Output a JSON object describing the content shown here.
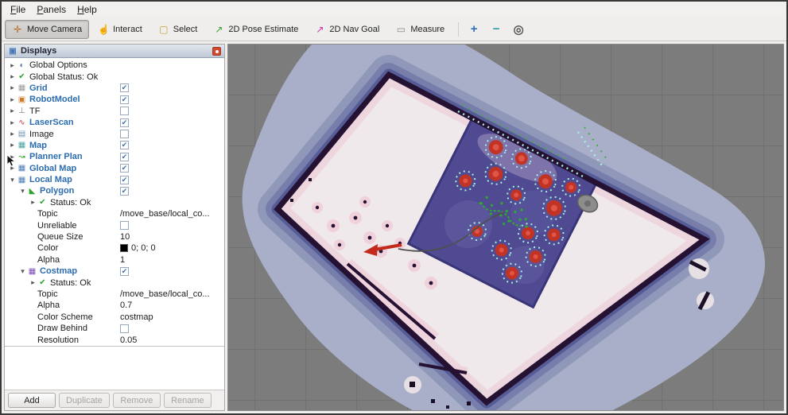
{
  "colors": {
    "accent_blue": "#2b6cb0",
    "viewport_bg": "#7c7c7c",
    "wall": "#251233",
    "inflation_blue": "#a9afc9",
    "costmap_square": "#46418c",
    "lethal_red": "#c03325",
    "laser_green": "#2ea82e",
    "speckle_cyan": "#a8ece4",
    "pose_arrow_red": "#c22a1c",
    "close_button_red": "#d2492f"
  },
  "menu": {
    "items": [
      "File",
      "Panels",
      "Help"
    ]
  },
  "toolbar": {
    "tools": [
      {
        "label": "Move Camera",
        "icon": "move-camera-icon",
        "active": true
      },
      {
        "label": "Interact",
        "icon": "interact-icon",
        "active": false
      },
      {
        "label": "Select",
        "icon": "select-icon",
        "active": false
      },
      {
        "label": "2D Pose Estimate",
        "icon": "pose-estimate-icon",
        "active": false
      },
      {
        "label": "2D Nav Goal",
        "icon": "nav-goal-icon",
        "active": false
      },
      {
        "label": "Measure",
        "icon": "measure-icon",
        "active": false
      }
    ],
    "extra_buttons": [
      {
        "name": "add-tool",
        "icon": "plus-icon"
      },
      {
        "name": "remove-tool",
        "icon": "minus-icon"
      },
      {
        "name": "focus-camera",
        "icon": "focus-icon"
      }
    ]
  },
  "icons": {
    "move-camera-icon": {
      "glyph": "✛",
      "color": "#b86e2a"
    },
    "interact-icon": {
      "glyph": "☝",
      "color": "#b8932a"
    },
    "select-icon": {
      "glyph": "▢",
      "color": "#c3a42b"
    },
    "pose-estimate-icon": {
      "glyph": "↗",
      "color": "#2da12d"
    },
    "nav-goal-icon": {
      "glyph": "↗",
      "color": "#cc2fa0"
    },
    "measure-icon": {
      "glyph": "▭",
      "color": "#8a8a8a"
    },
    "plus-icon": {
      "glyph": "+",
      "color": "#2f6fb3"
    },
    "minus-icon": {
      "glyph": "−",
      "color": "#2e9e9e"
    },
    "focus-icon": {
      "glyph": "◎",
      "color": "#555555"
    },
    "displays-icon": {
      "glyph": "▣",
      "color": "#4a7ab5"
    },
    "global-options-icon": {
      "glyph": "◐",
      "color": "#5b7aa0"
    },
    "ok-icon": {
      "glyph": "✔",
      "color": "#2da12d"
    },
    "grid-icon": {
      "glyph": "▦",
      "color": "#9a9a9a"
    },
    "robot-icon": {
      "glyph": "▣",
      "color": "#d07a2a"
    },
    "tf-icon": {
      "glyph": "⊥",
      "color": "#777777"
    },
    "laser-icon": {
      "glyph": "∿",
      "color": "#cc3333"
    },
    "image-icon": {
      "glyph": "▤",
      "color": "#6a8fae"
    },
    "map-icon": {
      "glyph": "▦",
      "color": "#4aa0a0"
    },
    "plan-icon": {
      "glyph": "↝",
      "color": "#2da12d"
    },
    "group-map-icon": {
      "glyph": "▦",
      "color": "#4a7ab5"
    },
    "polygon-icon": {
      "glyph": "◣",
      "color": "#2da12d"
    },
    "costmap-icon": {
      "glyph": "▦",
      "color": "#7a4ab5"
    }
  },
  "displays": {
    "title": "Displays",
    "tree": [
      {
        "label": "Global Options",
        "icon": "global-options-icon",
        "arrow": "right",
        "indent": 0
      },
      {
        "label": "Global Status: Ok",
        "icon": "ok-icon",
        "arrow": "right",
        "indent": 0
      },
      {
        "label": "Grid",
        "icon": "grid-icon",
        "arrow": "right",
        "indent": 0,
        "blue": true,
        "check": true
      },
      {
        "label": "RobotModel",
        "icon": "robot-icon",
        "arrow": "right",
        "indent": 0,
        "blue": true,
        "check": true
      },
      {
        "label": "TF",
        "icon": "tf-icon",
        "arrow": "right",
        "indent": 0,
        "check": false
      },
      {
        "label": "LaserScan",
        "icon": "laser-icon",
        "arrow": "right",
        "indent": 0,
        "blue": true,
        "check": true
      },
      {
        "label": "Image",
        "icon": "image-icon",
        "arrow": "right",
        "indent": 0,
        "check": false
      },
      {
        "label": "Map",
        "icon": "map-icon",
        "arrow": "right",
        "indent": 0,
        "blue": true,
        "check": true
      },
      {
        "label": "Planner Plan",
        "icon": "plan-icon",
        "arrow": "right",
        "indent": 0,
        "blue": true,
        "check": true
      },
      {
        "label": "Global Map",
        "icon": "group-map-icon",
        "arrow": "right",
        "indent": 0,
        "blue": true,
        "check": true
      },
      {
        "label": "Local Map",
        "icon": "group-map-icon",
        "arrow": "down",
        "indent": 0,
        "blue": true,
        "check": true
      },
      {
        "label": "Polygon",
        "icon": "polygon-icon",
        "arrow": "down",
        "indent": 1,
        "blue": true,
        "check": true
      },
      {
        "label": "Status: Ok",
        "icon": "ok-icon",
        "arrow": "right",
        "indent": 2
      },
      {
        "label": "Topic",
        "indent": 2,
        "value": "/move_base/local_co..."
      },
      {
        "label": "Unreliable",
        "indent": 2,
        "check": false
      },
      {
        "label": "Queue Size",
        "indent": 2,
        "value": "10"
      },
      {
        "label": "Color",
        "indent": 2,
        "value": "0; 0; 0",
        "swatch": "#000000"
      },
      {
        "label": "Alpha",
        "indent": 2,
        "value": "1"
      },
      {
        "label": "Costmap",
        "icon": "costmap-icon",
        "arrow": "down",
        "indent": 1,
        "blue": true,
        "check": true
      },
      {
        "label": "Status: Ok",
        "icon": "ok-icon",
        "arrow": "right",
        "indent": 2
      },
      {
        "label": "Topic",
        "indent": 2,
        "value": "/move_base/local_co..."
      },
      {
        "label": "Alpha",
        "indent": 2,
        "value": "0.7"
      },
      {
        "label": "Color Scheme",
        "indent": 2,
        "value": "costmap"
      },
      {
        "label": "Draw Behind",
        "indent": 2,
        "check": false
      },
      {
        "label": "Resolution",
        "indent": 2,
        "value": "0.05"
      }
    ],
    "buttons": [
      {
        "label": "Add",
        "enabled": true
      },
      {
        "label": "Duplicate",
        "enabled": false
      },
      {
        "label": "Remove",
        "enabled": false
      },
      {
        "label": "Rename",
        "enabled": false
      }
    ]
  }
}
